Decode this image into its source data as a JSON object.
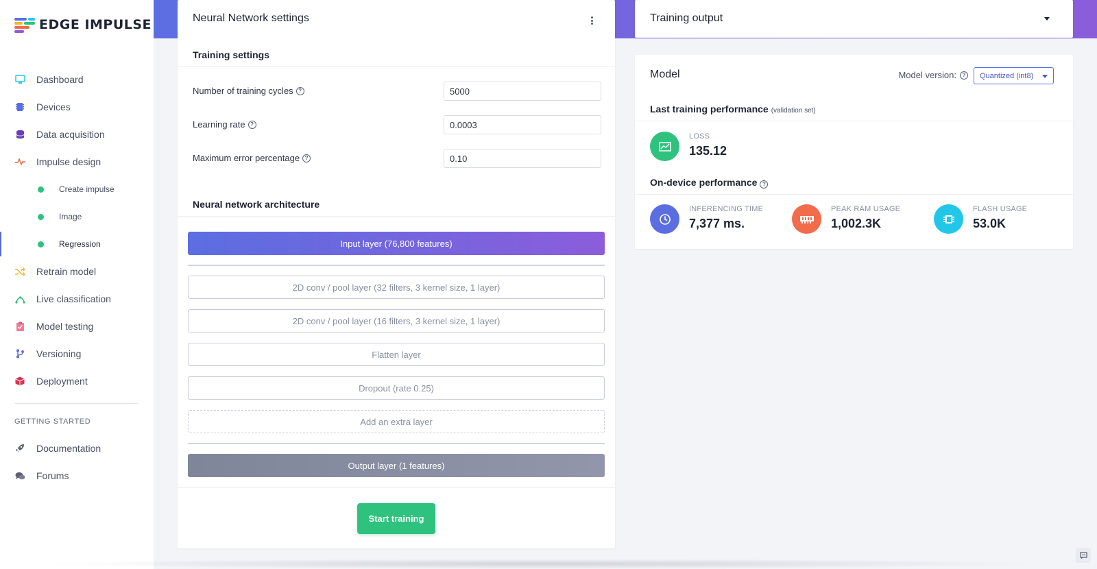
{
  "app": {
    "logo_text": "EDGE IMPULSE"
  },
  "sidebar": {
    "items": [
      {
        "label": "Dashboard",
        "icon": "monitor-icon"
      },
      {
        "label": "Devices",
        "icon": "chip-icon"
      },
      {
        "label": "Data acquisition",
        "icon": "database-icon"
      },
      {
        "label": "Impulse design",
        "icon": "pulse-icon"
      },
      {
        "label": "Create impulse",
        "icon": "dot-icon"
      },
      {
        "label": "Image",
        "icon": "dot-icon"
      },
      {
        "label": "Regression",
        "icon": "dot-icon",
        "active": true
      },
      {
        "label": "Retrain model",
        "icon": "shuffle-icon"
      },
      {
        "label": "Live classification",
        "icon": "live-icon"
      },
      {
        "label": "Model testing",
        "icon": "clipboard-check-icon"
      },
      {
        "label": "Versioning",
        "icon": "branch-icon"
      },
      {
        "label": "Deployment",
        "icon": "box-icon"
      }
    ],
    "getting_started_label": "GETTING STARTED",
    "getting_started": [
      {
        "label": "Documentation",
        "icon": "rocket-icon"
      },
      {
        "label": "Forums",
        "icon": "chat-icon"
      }
    ]
  },
  "nn_settings": {
    "title": "Neural Network settings",
    "training_settings_label": "Training settings",
    "fields": [
      {
        "label": "Number of training cycles",
        "value": "5000"
      },
      {
        "label": "Learning rate",
        "value": "0.0003"
      },
      {
        "label": "Maximum error percentage",
        "value": "0.10"
      }
    ],
    "architecture_label": "Neural network architecture",
    "input_layer": "Input layer (76,800 features)",
    "layers": [
      "2D conv / pool layer (32 filters, 3 kernel size, 1 layer)",
      "2D conv / pool layer (16 filters, 3 kernel size, 1 layer)",
      "Flatten layer",
      "Dropout (rate 0.25)"
    ],
    "add_layer": "Add an extra layer",
    "output_layer": "Output layer (1 features)",
    "start_button": "Start training"
  },
  "training_output": {
    "title": "Training output"
  },
  "model": {
    "title": "Model",
    "version_label": "Model version:",
    "version_value": "Quantized (int8)",
    "last_perf_title": "Last training performance",
    "last_perf_note": "(validation set)",
    "loss_label": "LOSS",
    "loss_value": "135.12",
    "on_device_title": "On-device performance",
    "metrics": [
      {
        "label": "INFERENCING TIME",
        "value": "7,377 ms.",
        "color": "#5b6ee1"
      },
      {
        "label": "PEAK RAM USAGE",
        "value": "1,002.3K",
        "color": "#f26b4b"
      },
      {
        "label": "FLASH USAGE",
        "value": "53.0K",
        "color": "#22c7e8"
      }
    ]
  },
  "colors": {
    "accent": "#5b6ee1",
    "success": "#2ec27e",
    "purple": "#8b5ddb"
  }
}
